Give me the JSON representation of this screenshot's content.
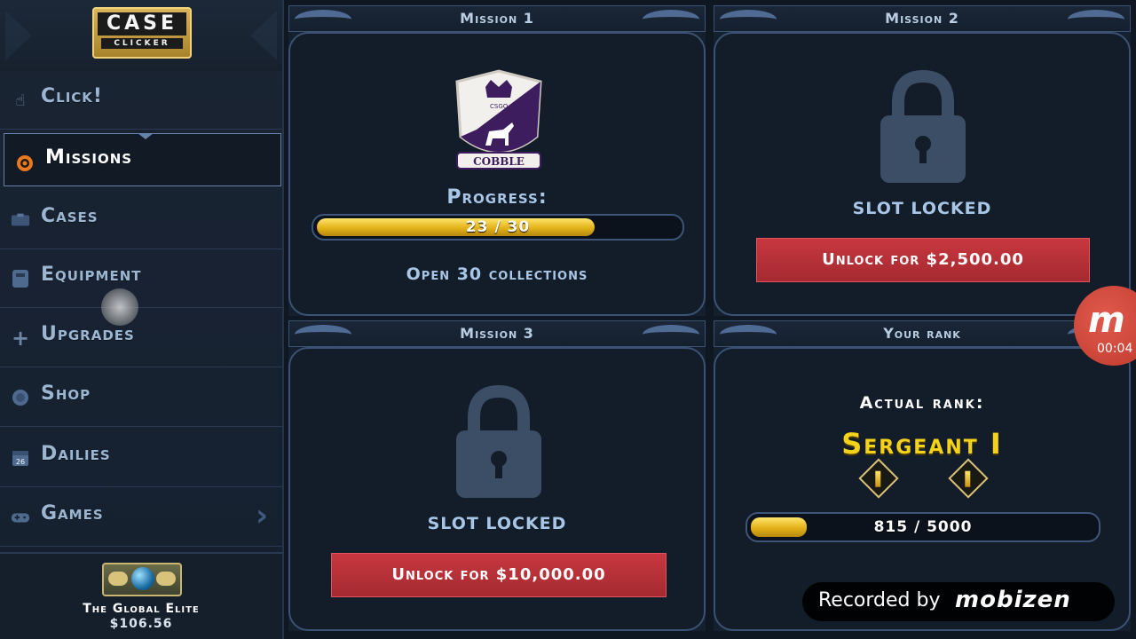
{
  "app": {
    "logo": {
      "line1": "CASE",
      "line2": "CLICKER"
    }
  },
  "sidebar": {
    "items": [
      {
        "label": "Click!",
        "icon": "pointer-hand-icon"
      },
      {
        "label": "Missions",
        "icon": "target-icon",
        "active": true
      },
      {
        "label": "Cases",
        "icon": "case-icon"
      },
      {
        "label": "Equipment",
        "icon": "locker-icon"
      },
      {
        "label": "Upgrades",
        "icon": "plus-icon"
      },
      {
        "label": "Shop",
        "icon": "coin-icon"
      },
      {
        "label": "Dailies",
        "icon": "calendar-icon",
        "icon_text": "26"
      },
      {
        "label": "Games",
        "icon": "gamepad-icon",
        "chevron": "›"
      }
    ],
    "profile": {
      "rank_name": "The Global Elite",
      "money": "$106.56",
      "badge_icon": "global-elite-badge-icon"
    }
  },
  "missions": {
    "mission1": {
      "title": "Mission 1",
      "crest_icon": "cobble-crest-icon",
      "crest_text": "COBBLE",
      "crest_sub": "CSGO",
      "progress_label": "Progress:",
      "progress_current": 23,
      "progress_total": 30,
      "progress_text": "23 / 30",
      "description": "Open 30 collections"
    },
    "mission2": {
      "title": "Mission 2",
      "locked_label": "SLOT LOCKED",
      "unlock_button": "Unlock for $2,500.00"
    },
    "mission3": {
      "title": "Mission 3",
      "locked_label": "SLOT LOCKED",
      "unlock_button": "Unlock for $10,000.00"
    },
    "rank": {
      "title": "Your rank",
      "heading": "Actual rank:",
      "rank_title": "Sergeant I",
      "xp_current": 815,
      "xp_total": 5000,
      "xp_text": "815 / 5000"
    }
  },
  "overlays": {
    "recorder_time": "00:04",
    "recorder_logo": "m",
    "recorded_by": "Recorded by",
    "recorded_brand": "mobizen"
  },
  "colors": {
    "accent_gold": "#f5d21a",
    "unlock_red": "#c8373f",
    "nav_text": "#9cb6d2"
  }
}
